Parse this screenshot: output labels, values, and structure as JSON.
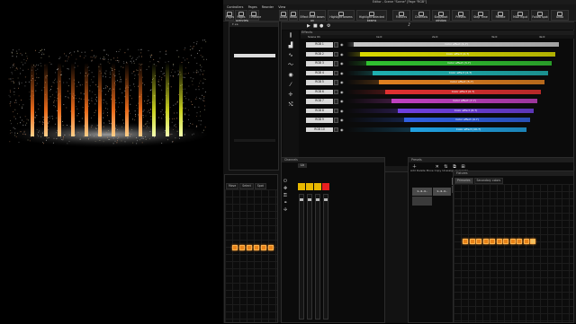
{
  "window": {
    "title": "Editor - Scene \"Scene\" [Page \"RGB\"]"
  },
  "menu": [
    "Controllers",
    "Pages",
    "Reorder",
    "View"
  ],
  "toolbar": {
    "left_buttons": [
      "Pages",
      "Pages overview",
      "Timeline"
    ],
    "undo_label": "Undo",
    "redo_label": "Redo",
    "effect_label": "Effect level beam on",
    "highlight_beams": "Highlight beams",
    "highlight_selected": "Highlight selected beams",
    "right_buttons": [
      "Fixtures",
      "Channels",
      "Step/beat window",
      "Presets",
      "Step Time",
      "Palette",
      "MIDI Input",
      "Follow spot",
      "Undo"
    ]
  },
  "timeline": {
    "header": "Effects",
    "ruler": [
      "Scene 01",
      "1s:0",
      "2s:0",
      "3s:0",
      "4s:0"
    ],
    "tracks": [
      {
        "name": "RGB 1",
        "clip": "Color effect (1-7)",
        "color": "#c8c8c8"
      },
      {
        "name": "RGB 2",
        "clip": "Color effect (2-7)",
        "color": "#d9d900"
      },
      {
        "name": "RGB 3",
        "clip": "Color effect (3-7)",
        "color": "#30c030"
      },
      {
        "name": "RGB 4",
        "clip": "Color effect (4-7)",
        "color": "#1fb0b0"
      },
      {
        "name": "RGB 5",
        "clip": "Color effect (5-7)",
        "color": "#e08020"
      },
      {
        "name": "RGB 6",
        "clip": "Color effect (6-7)",
        "color": "#e03030"
      },
      {
        "name": "RGB 7",
        "clip": "Color effect (7-7)",
        "color": "#c040c0"
      },
      {
        "name": "RGB 8",
        "clip": "Color effect (8-7)",
        "color": "#7040e0"
      },
      {
        "name": "RGB 9",
        "clip": "Color effect (9-7)",
        "color": "#3060e0"
      },
      {
        "name": "RGB 10",
        "clip": "Color effect (10-7)",
        "color": "#20a0e0"
      }
    ]
  },
  "fixture_panel": {
    "tabs": [
      "Move",
      "Select",
      "Spot",
      "Scenes",
      "FX",
      "Dev"
    ]
  },
  "channels": {
    "title": "Channels",
    "input_label": "Lk"
  },
  "presets": {
    "title": "Presets",
    "tabs": [
      "Add",
      "Delete",
      "Move",
      "Copy",
      "Unassign",
      "Complete"
    ],
    "groups": [
      "1..4..4..",
      "Wait Prev",
      "#",
      "1..4..4.."
    ],
    "sub_tabs": [
      "Primaries",
      "Secondary colors"
    ]
  },
  "layout_panel": {
    "title": "Fixtures"
  },
  "colors": {
    "accent": "#e8841a",
    "selected": "#3a5a7a",
    "panel_bg": "#0b0b0b"
  }
}
